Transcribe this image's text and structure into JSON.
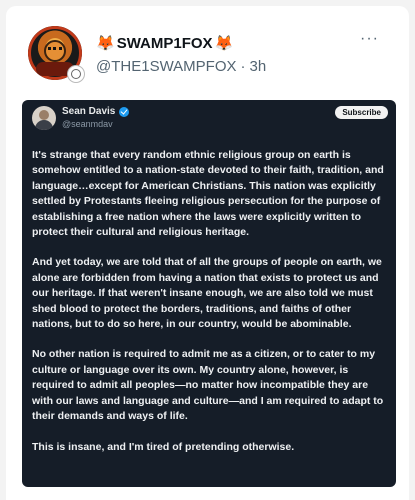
{
  "post": {
    "display_name": "SWAMP1FOX",
    "name_emoji_left": "🦊",
    "name_emoji_right": "🦊",
    "handle": "@THE1SWAMPFOX",
    "separator": "·",
    "time": "3h",
    "more_label": "···"
  },
  "embedded": {
    "name": "Sean Davis",
    "handle": "@seanmdav",
    "subscribe_label": "Subscribe",
    "paragraphs": [
      "It's strange that every random ethnic religious group on earth is somehow entitled to a nation-state devoted to their faith, tradition, and language…except for American Christians. This nation was explicitly settled by Protestants fleeing religious persecution for the purpose of establishing a free nation where the laws were explicitly written to protect their cultural and religious heritage.",
      "And yet today, we are told that of all the groups of people on earth, we alone are forbidden from having a nation that exists to protect us and our heritage. If that weren't insane enough, we are also told we must shed blood to protect the borders, traditions, and faiths of other nations, but to do so here, in our country, would be abominable.",
      "No other nation is required to admit me as a citizen, or to cater to my culture or language over its own. My country alone, however, is required to admit all peoples—no matter how incompatible they are with our laws and language and culture—and I am required to adapt to their demands and ways of life.",
      "This is insane, and I'm tired of pretending otherwise."
    ]
  },
  "colors": {
    "verified": "#1d9bf0",
    "media_bg": "#151d28"
  }
}
